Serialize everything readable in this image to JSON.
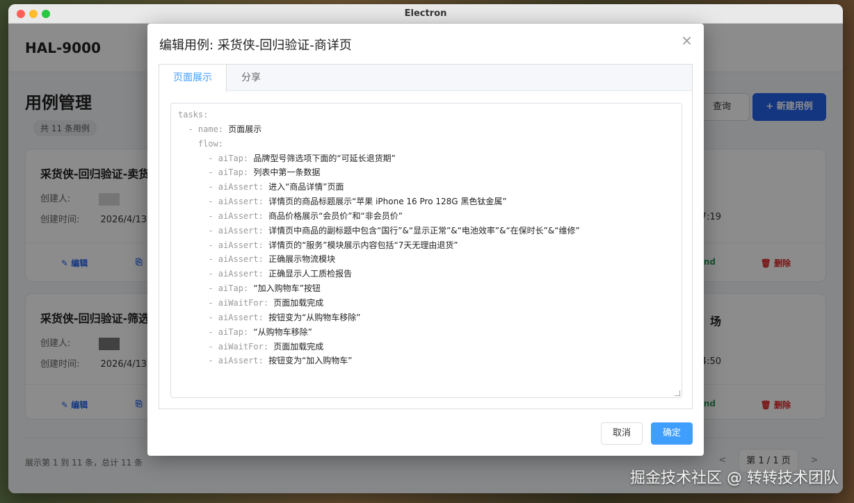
{
  "window": {
    "title": "Electron"
  },
  "app": {
    "brand": "HAL-9000",
    "page_title": "用例管理",
    "count_badge": "共 11 条用例",
    "query_button": "查询",
    "new_button": "+ 新建用例"
  },
  "cards": [
    {
      "title": "采货侠-回归验证-卖货",
      "creator_label": "创建人:",
      "time_label": "创建时间:",
      "time_value": "2026/4/13 1",
      "right_time": "7:19",
      "right_title": "",
      "actions": {
        "edit": "✎ 编辑",
        "copy": "⎘",
        "bind": "ind",
        "delete": "🗑 删除"
      }
    },
    {
      "title": "采货侠-回归验证-筛选",
      "creator_label": "创建人:",
      "time_label": "创建时间:",
      "time_value": "2026/4/13 1",
      "right_time": "4:50",
      "right_title": "场",
      "actions": {
        "edit": "✎ 编辑",
        "copy": "⎘",
        "bind": "ind",
        "delete": "🗑 删除"
      }
    }
  ],
  "footer": {
    "summary": "展示第 1 到 11 条，总计 11 条",
    "prev": "<",
    "page": "第 1 / 1 页",
    "next": ">"
  },
  "modal": {
    "title": "编辑用例: 采货侠-回归验证-商详页",
    "close": "×",
    "tabs": [
      "页面展示",
      "分享"
    ],
    "active_tab": "页面展示",
    "cancel": "取消",
    "confirm": "确定",
    "code_lines": [
      {
        "indent": "",
        "key": "tasks:",
        "text": ""
      },
      {
        "indent": "  ",
        "key": "- name: ",
        "text": "页面展示"
      },
      {
        "indent": "    ",
        "key": "flow:",
        "text": ""
      },
      {
        "indent": "      ",
        "key": "- aiTap: ",
        "text": "品牌型号筛选项下面的“可延长退货期”"
      },
      {
        "indent": "      ",
        "key": "- aiTap: ",
        "text": "列表中第一条数据"
      },
      {
        "indent": "      ",
        "key": "- aiAssert: ",
        "text": "进入“商品详情”页面"
      },
      {
        "indent": "      ",
        "key": "- aiAssert: ",
        "text": "详情页的商品标题展示“苹果 iPhone 16 Pro 128G 黑色钛金属”"
      },
      {
        "indent": "      ",
        "key": "- aiAssert: ",
        "text": "商品价格展示“会员价”和“非会员价”"
      },
      {
        "indent": "      ",
        "key": "- aiAssert: ",
        "text": "详情页中商品的副标题中包含“国行”&“显示正常”&“电池效率”&“在保时长”&“维修”"
      },
      {
        "indent": "      ",
        "key": "- aiAssert: ",
        "text": "详情页的“服务”模块展示内容包括“7天无理由退货”"
      },
      {
        "indent": "      ",
        "key": "- aiAssert: ",
        "text": "正确展示物流模块"
      },
      {
        "indent": "      ",
        "key": "- aiAssert: ",
        "text": "正确显示人工质检报告"
      },
      {
        "indent": "      ",
        "key": "- aiTap: ",
        "text": "“加入购物车”按钮"
      },
      {
        "indent": "      ",
        "key": "- aiWaitFor: ",
        "text": "页面加载完成"
      },
      {
        "indent": "      ",
        "key": "- aiAssert: ",
        "text": "按钮变为“从购物车移除”"
      },
      {
        "indent": "      ",
        "key": "- aiTap: ",
        "text": "“从购物车移除”"
      },
      {
        "indent": "      ",
        "key": "- aiWaitFor: ",
        "text": "页面加载完成"
      },
      {
        "indent": "      ",
        "key": "- aiAssert: ",
        "text": "按钮变为“加入购物车”"
      }
    ]
  },
  "watermark": "掘金技术社区 @ 转转技术团队"
}
